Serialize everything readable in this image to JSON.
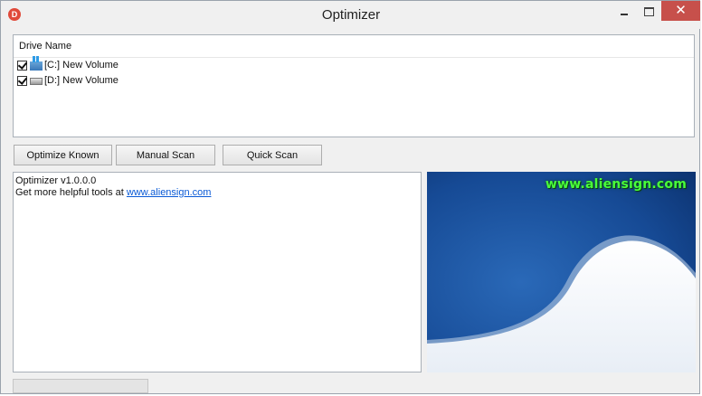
{
  "window": {
    "title": "Optimizer",
    "app_icon_letter": "D",
    "close_glyph": "✕",
    "accent_close": "#c7504b"
  },
  "drive_list": {
    "header": "Drive Name",
    "drives": [
      {
        "label": "[C:] New Volume",
        "checked": true,
        "icon": "windows-drive-icon"
      },
      {
        "label": "[D:] New Volume",
        "checked": true,
        "icon": "hard-drive-icon"
      }
    ]
  },
  "toolbar": {
    "optimize_known": "Optimize Known",
    "manual_scan": "Manual Scan",
    "quick_scan": "Quick Scan"
  },
  "log": {
    "line1": "Optimizer v1.0.0.0",
    "line2_prefix": "Get more helpful tools at ",
    "link_text": "www.aliensign.com"
  },
  "banner": {
    "text": "www.aliensign.com",
    "text_color": "#49ff3a",
    "bg_color": "#103a78"
  }
}
